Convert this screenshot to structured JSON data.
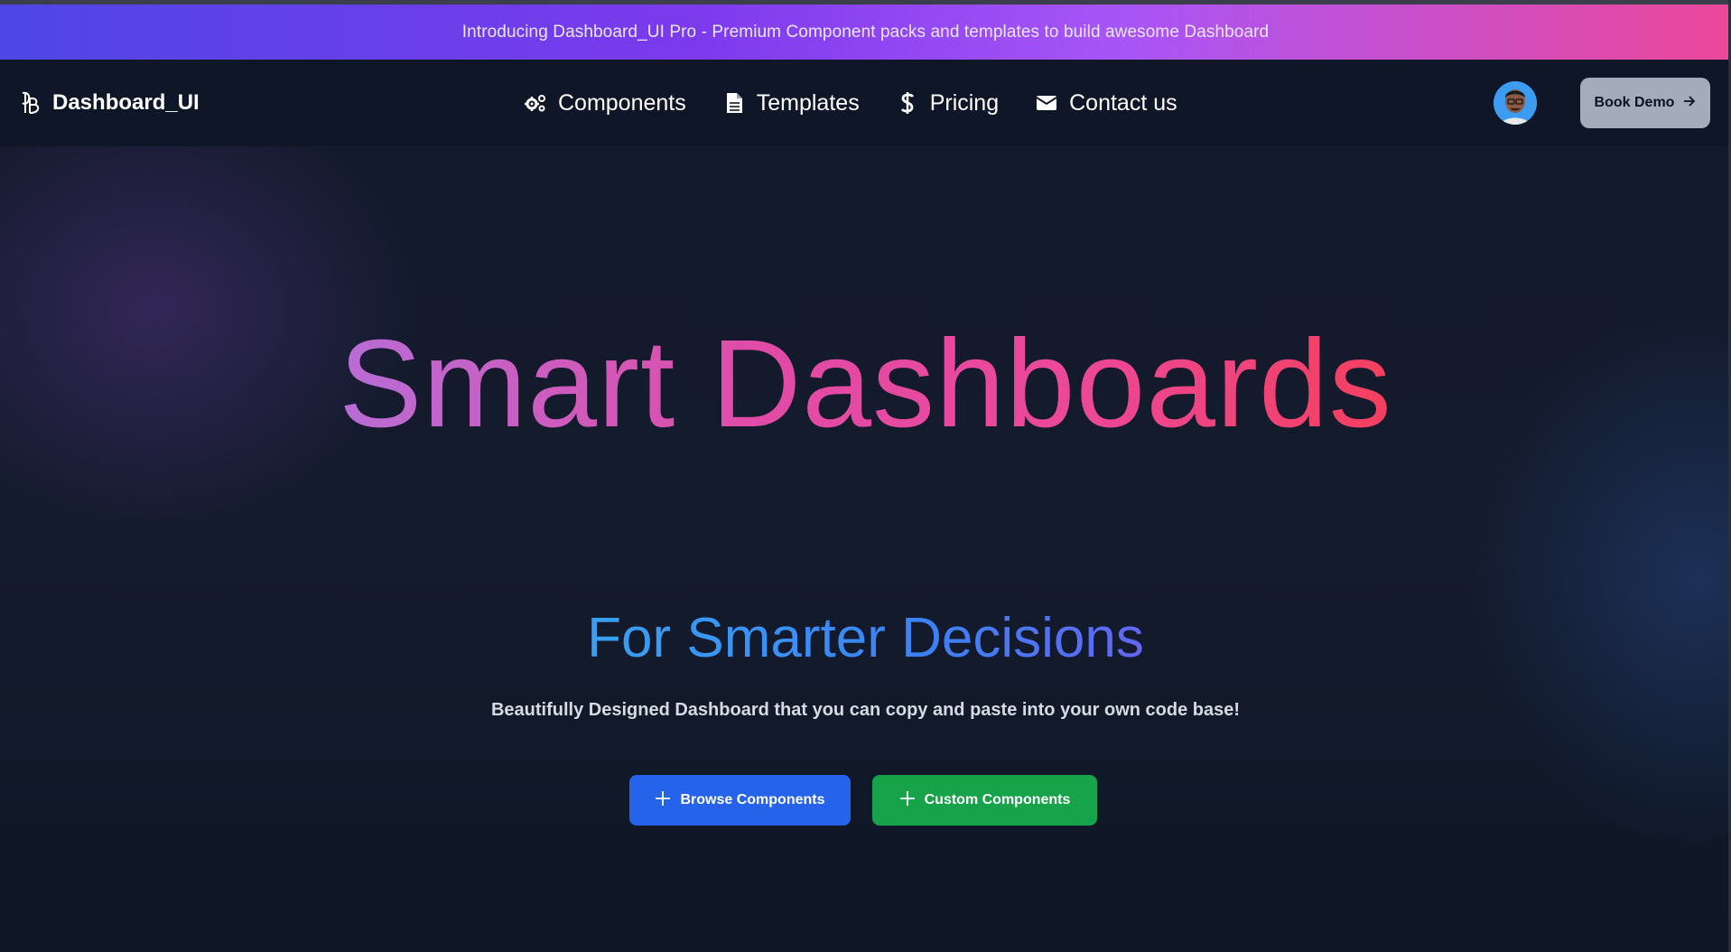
{
  "announcement": {
    "text": "Introducing Dashboard_UI Pro - Premium Component packs and templates to build awesome Dashboard"
  },
  "brand": {
    "name": "Dashboard_UI",
    "logo_icon": "db-monogram-icon"
  },
  "nav": {
    "items": [
      {
        "label": "Components",
        "icon": "gears-icon"
      },
      {
        "label": "Templates",
        "icon": "document-icon"
      },
      {
        "label": "Pricing",
        "icon": "dollar-icon"
      },
      {
        "label": "Contact us",
        "icon": "envelope-icon"
      }
    ]
  },
  "header": {
    "book_demo_label": "Book Demo",
    "book_demo_icon": "arrow-right-icon"
  },
  "hero": {
    "headline": "Smart Dashboards",
    "subheadline": "For Smarter Decisions",
    "tagline": "Beautifully Designed Dashboard that you can copy and paste into your own code base!",
    "primary_cta": "Browse Components",
    "secondary_cta": "Custom Components",
    "cta_icon": "plus-icon"
  },
  "colors": {
    "announcement_start": "#4f46e5",
    "announcement_end": "#ec4899",
    "navbar_bg": "#0f1627",
    "primary_button": "#2563eb",
    "secondary_button": "#16a34a",
    "book_demo_bg": "#a3acbb"
  }
}
